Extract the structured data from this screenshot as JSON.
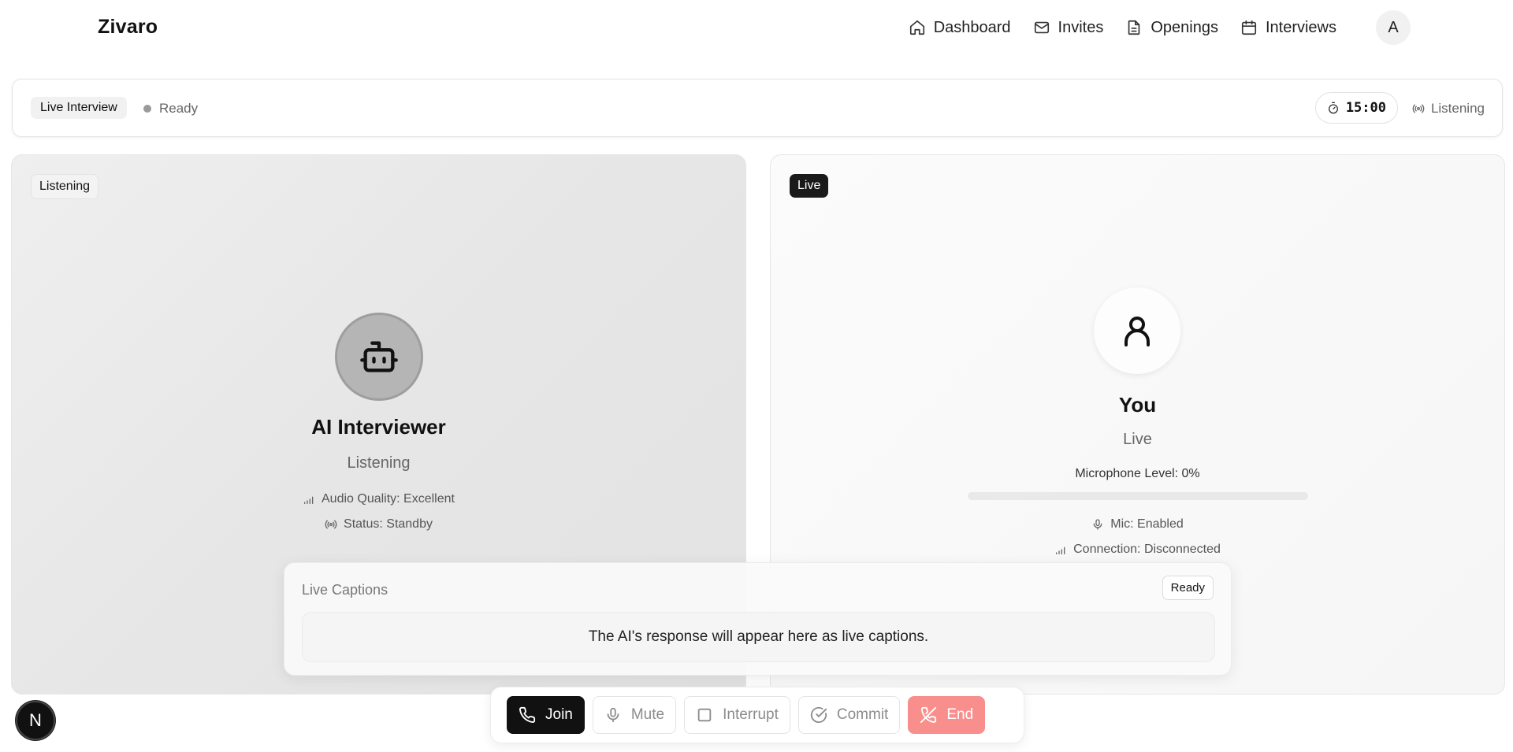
{
  "nav": {
    "brand": "Zivaro",
    "links": [
      {
        "label": "Dashboard",
        "icon": "home-icon"
      },
      {
        "label": "Invites",
        "icon": "mail-icon"
      },
      {
        "label": "Openings",
        "icon": "document-icon"
      },
      {
        "label": "Interviews",
        "icon": "calendar-icon"
      }
    ],
    "avatar_initial": "A"
  },
  "status_bar": {
    "mode_label": "Live Interview",
    "state_label": "Ready",
    "timer": "15:00",
    "listening_label": "Listening"
  },
  "ai_panel": {
    "badge": "Listening",
    "name": "AI Interviewer",
    "state": "Listening",
    "audio_quality": "Audio Quality: Excellent",
    "status": "Status: Standby"
  },
  "you_panel": {
    "badge": "Live",
    "name": "You",
    "state": "Live",
    "mic_level_label": "Microphone Level: 0%",
    "mic_level": 0,
    "mic": "Mic: Enabled",
    "connection": "Connection: Disconnected"
  },
  "captions": {
    "title": "Live Captions",
    "status": "Ready",
    "text": "The AI's response will appear here as live captions."
  },
  "controls": {
    "join": "Join",
    "mute": "Mute",
    "interrupt": "Interrupt",
    "commit": "Commit",
    "end": "End"
  },
  "dev_badge": "N",
  "colors": {
    "end_button": "#f88f8c",
    "join_button": "#111111",
    "ai_avatar_bg": "#b5b5b5"
  }
}
